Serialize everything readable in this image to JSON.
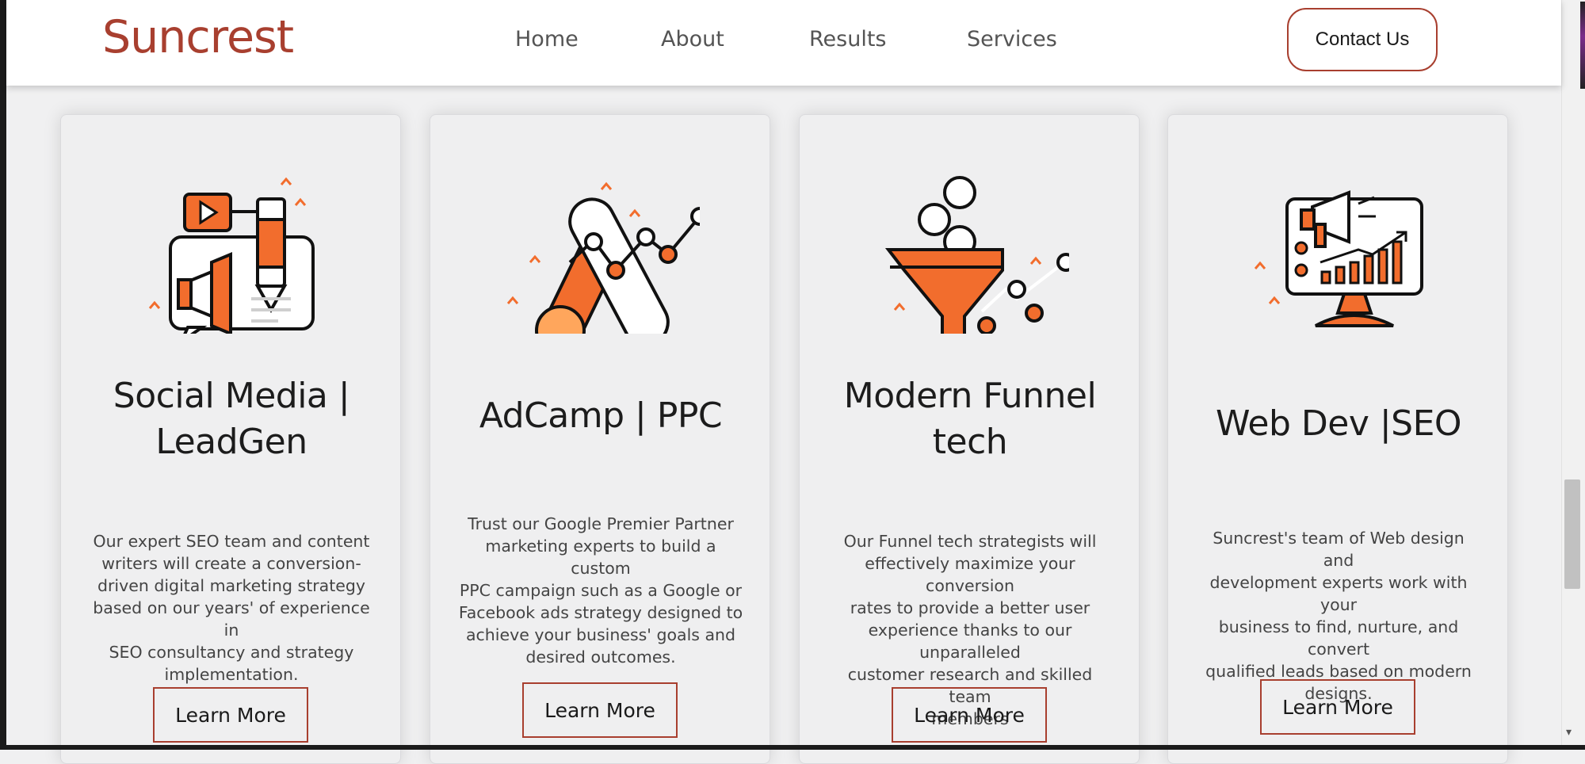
{
  "header": {
    "logo": "Suncrest",
    "nav": [
      "Home",
      "About",
      "Results",
      "Services"
    ],
    "contact_label": "Contact Us"
  },
  "colors": {
    "brand": "#a83f2f",
    "accent": "#f26d2d",
    "accent_light": "#ffa65c"
  },
  "cards": [
    {
      "icon": "social-media-megaphone-icon",
      "title_lines": [
        "Social Media |",
        "LeadGen"
      ],
      "desc_lines": [
        "Our expert SEO team and content",
        "writers will create a conversion-",
        "driven digital marketing strategy",
        "based on our years' of experience in",
        "SEO consultancy and strategy",
        "implementation."
      ],
      "button": "Learn More"
    },
    {
      "icon": "google-ads-chart-icon",
      "title_lines": [
        "AdCamp | PPC"
      ],
      "desc_lines": [
        "Trust our Google Premier Partner",
        "marketing experts to build a custom",
        "PPC campaign such as a Google or",
        "Facebook ads strategy designed to",
        "achieve your business' goals and",
        "desired outcomes."
      ],
      "button": "Learn More"
    },
    {
      "icon": "funnel-conversion-icon",
      "title_lines": [
        "Modern Funnel",
        "tech"
      ],
      "desc_lines": [
        "Our Funnel tech strategists will",
        "effectively maximize your conversion",
        "rates to provide a better user",
        "experience thanks to our unparalleled",
        "customer research and skilled team",
        "members"
      ],
      "button": "Learn More"
    },
    {
      "icon": "monitor-growth-icon",
      "title_lines": [
        "Web Dev |SEO"
      ],
      "desc_lines": [
        "Suncrest's team of Web design and",
        "development experts work with your",
        "business to find, nurture, and convert",
        "qualified leads based on modern",
        "designs."
      ],
      "button": "Learn More"
    }
  ]
}
